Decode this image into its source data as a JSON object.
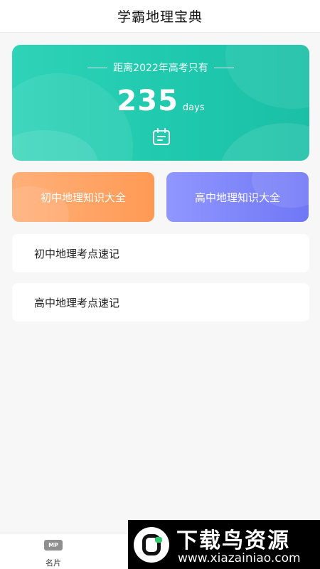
{
  "header": {
    "title": "学霸地理宝典"
  },
  "countdown": {
    "subtitle": "距离2022年高考只有",
    "days": "235",
    "unit": "days",
    "icon": "calendar-icon"
  },
  "quick_buttons": [
    {
      "label": "初中地理知识大全",
      "color": "#ff9d5c"
    },
    {
      "label": "高中地理知识大全",
      "color": "#7a80f7"
    }
  ],
  "list": [
    {
      "label": "初中地理考点速记"
    },
    {
      "label": "高中地理考点速记"
    }
  ],
  "tabbar": {
    "card_tab": {
      "icon_text": "MP",
      "label": "名片"
    }
  },
  "watermark": {
    "title": "下载鸟资源",
    "url": "www.xiazainiao.com"
  },
  "colors": {
    "teal": "#22c9ae",
    "orange": "#ff9d5c",
    "violet": "#7a80f7"
  }
}
